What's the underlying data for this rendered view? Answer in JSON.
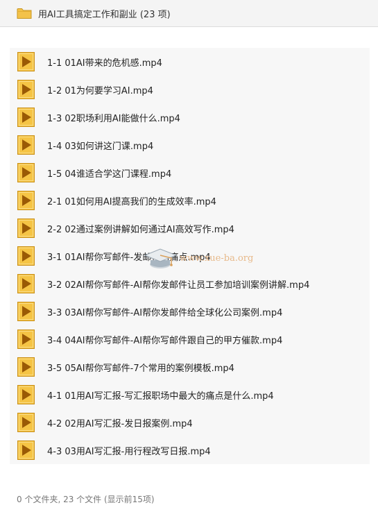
{
  "header": {
    "icon": "folder-icon",
    "title": "用AI工具搞定工作和副业 (23 项)"
  },
  "files": [
    {
      "name": "1-1 01AI带来的危机感.mp4",
      "icon": "video-file-icon"
    },
    {
      "name": "1-2 01为何要学习AI.mp4",
      "icon": "video-file-icon"
    },
    {
      "name": "1-3 02职场利用AI能做什么.mp4",
      "icon": "video-file-icon"
    },
    {
      "name": "1-4 03如何讲这门课.mp4",
      "icon": "video-file-icon"
    },
    {
      "name": "1-5 04谁适合学这门课程.mp4",
      "icon": "video-file-icon"
    },
    {
      "name": "2-1 01如何用AI提高我们的生成效率.mp4",
      "icon": "video-file-icon"
    },
    {
      "name": "2-2 02通过案例讲解如何通过AI高效写作.mp4",
      "icon": "video-file-icon"
    },
    {
      "name": "3-1 01AI帮你写邮件-发邮件的痛点.mp4",
      "icon": "video-file-icon"
    },
    {
      "name": "3-2 02AI帮你写邮件-AI帮你发邮件让员工参加培训案例讲解.mp4",
      "icon": "video-file-icon"
    },
    {
      "name": "3-3 03AI帮你写邮件-AI帮你发邮件给全球化公司案例.mp4",
      "icon": "video-file-icon"
    },
    {
      "name": "3-4 04AI帮你写邮件-AI帮你写邮件跟自己的甲方催款.mp4",
      "icon": "video-file-icon"
    },
    {
      "name": "3-5 05AI帮你写邮件-7个常用的案例模板.mp4",
      "icon": "video-file-icon"
    },
    {
      "name": "4-1 01用AI写汇报-写汇报职场中最大的痛点是什么.mp4",
      "icon": "video-file-icon"
    },
    {
      "name": "4-2 02用AI写汇报-发日报案例.mp4",
      "icon": "video-file-icon"
    },
    {
      "name": "4-3 03用AI写汇报-用行程改写日报.mp4",
      "icon": "video-file-icon"
    }
  ],
  "watermark": {
    "icon": "graduation-cap-icon",
    "text": "www.xue-ba.org"
  },
  "footer": {
    "summary": "0 个文件夹, 23 个文件 (显示前15项)"
  },
  "colors": {
    "icon_fill": "#f5c445",
    "icon_border": "#c9901a",
    "icon_triangle": "#9a5a05",
    "list_background": "#f7f7f7",
    "watermark_text": "#e7b98a"
  }
}
